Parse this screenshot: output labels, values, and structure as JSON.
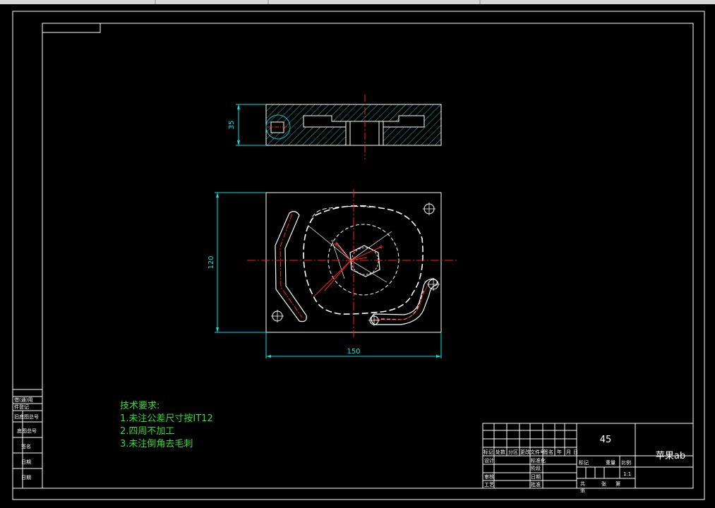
{
  "top_bar": {
    "color": "#d8d8d8"
  },
  "colors": {
    "background": "#000000",
    "outline": "#ffffff",
    "centerline": "#ff2020",
    "dimension": "#00e5e5",
    "hatch": "#00c8c8",
    "requirements": "#33dd33",
    "title_block_text": "#ffffff"
  },
  "dimensions": {
    "section_height": "35",
    "plan_height": "120",
    "plan_width": "150"
  },
  "requirements": {
    "heading": "技术要求:",
    "items": [
      "1.未注公差尺寸按IT12",
      "2.四周不加工",
      "3.未注倒角去毛刺"
    ]
  },
  "side_strip": {
    "labels": [
      "借(通)用",
      "件登记",
      "旧底图总号",
      "底图总号",
      "签名",
      "日期",
      "日期"
    ]
  },
  "title_block": {
    "material": "45",
    "part_name": "苹果ab",
    "scale": "1:1",
    "row_headers": [
      "标记",
      "处数",
      "分区",
      "更改文件号",
      "签名",
      "年",
      "月",
      "日"
    ],
    "sign_labels": [
      "设计",
      "标准化",
      "阶段",
      "标记",
      "重量",
      "比例"
    ],
    "review_labels": [
      "审核",
      "工艺",
      "批准"
    ],
    "misc_labels": [
      "日期",
      "共",
      "张",
      "第",
      "张"
    ]
  }
}
